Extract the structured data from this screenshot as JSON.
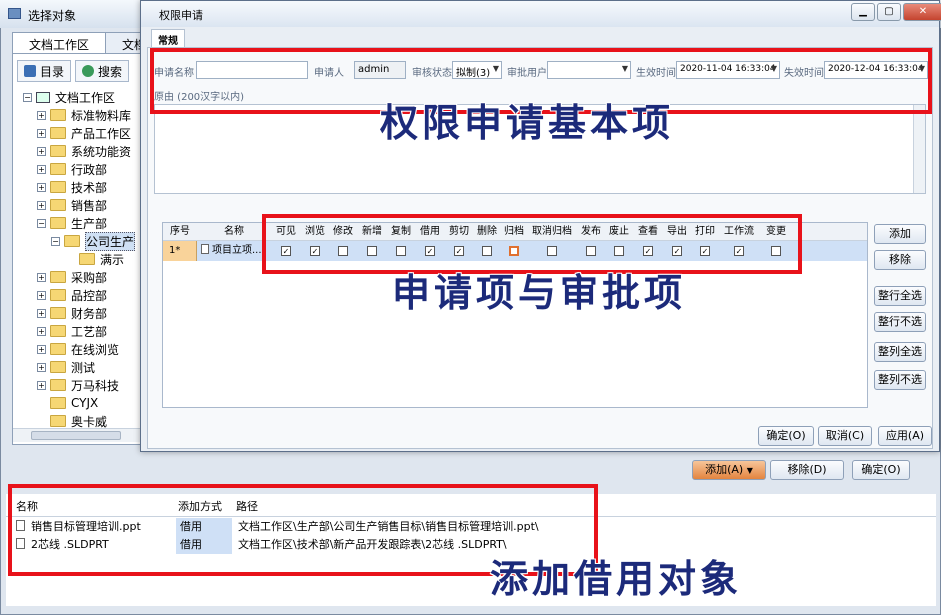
{
  "main_window": {
    "title": "选择对象"
  },
  "left_tabs": [
    "文档工作区",
    "文档"
  ],
  "left_buttons": {
    "catalog": "目录",
    "search": "搜索"
  },
  "tree": {
    "root": "文档工作区",
    "items": [
      "标准物料库",
      "产品工作区",
      "系统功能资",
      "行政部",
      "技术部",
      "销售部",
      "生产部"
    ],
    "sub": "公司生产",
    "subsub": "满示",
    "items2": [
      "采购部",
      "品控部",
      "财务部",
      "工艺部",
      "在线浏览",
      "测试",
      "万马科技",
      "CYJX",
      "奥卡威"
    ]
  },
  "dialog": {
    "title": "权限申请",
    "tab": "常规",
    "fields": {
      "name_label": "申请名称",
      "applicant_label": "申请人",
      "applicant_value": "admin",
      "status_label": "审核状态",
      "status_value": "拟制(3)",
      "approver_label": "审批用户",
      "effective_label": "生效时间",
      "effective_value": "2020-11-04 16:33:04",
      "expire_label": "失效时间",
      "expire_value": "2020-12-04 16:33:04",
      "reason_label": "原由 (200汉字以内)"
    },
    "grid": {
      "headers": [
        "序号",
        "名称",
        "可见",
        "浏览",
        "修改",
        "新增",
        "复制",
        "借用",
        "剪切",
        "删除",
        "归档",
        "取消归档",
        "发布",
        "废止",
        "查看",
        "导出",
        "打印",
        "工作流",
        "变更"
      ],
      "row": {
        "index": "1*",
        "name": "项目立项...",
        "checks": [
          true,
          true,
          false,
          false,
          false,
          true,
          true,
          false,
          false,
          false,
          false,
          false,
          true,
          true,
          true,
          true,
          false
        ]
      }
    },
    "side_buttons": [
      "添加",
      "移除",
      "整行全选",
      "整行不选",
      "整列全选",
      "整列不选"
    ],
    "bottom_buttons": [
      "确定(O)",
      "取消(C)",
      "应用(A)"
    ]
  },
  "main_buttons": {
    "add": "添加(A)",
    "remove": "移除(D)",
    "ok": "确定(O)"
  },
  "bottom_table": {
    "headers": [
      "名称",
      "添加方式",
      "路径"
    ],
    "rows": [
      {
        "name": "销售目标管理培训.ppt",
        "mode": "借用",
        "path": "文档工作区\\生产部\\公司生产销售目标\\销售目标管理培训.ppt\\"
      },
      {
        "name": "2芯线 .SLDPRT",
        "mode": "借用",
        "path": "文档工作区\\技术部\\新产品开发跟踪表\\2芯线 .SLDPRT\\"
      }
    ]
  },
  "annotations": {
    "a1": "权限申请基本项",
    "a2": "申请项与审批项",
    "a3": "添加借用对象"
  },
  "colors": {
    "annotation_border": "#e8121a",
    "annotation_text": "#1c2a7a"
  }
}
